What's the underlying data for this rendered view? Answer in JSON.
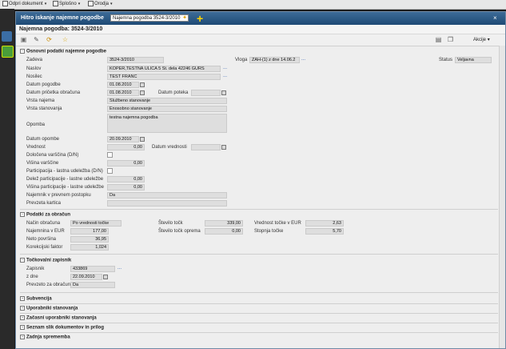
{
  "menu": {
    "items": [
      "Odpri dokument",
      "Splošno",
      "Orodja"
    ]
  },
  "window": {
    "title": "Hitro iskanje najemne pogodbe",
    "search_value": "Najemna pogodba 3524-3/2010",
    "close": "×"
  },
  "header": {
    "title": "Najemna pogodba: 3524-3/2010"
  },
  "toolbar": {
    "akcije": "Akcije"
  },
  "sections": {
    "osnovni": "Osnovni podatki najemne pogodbe",
    "obracun": "Podatki za obračun",
    "tockovalni": "Točkovalni zapisnik",
    "subvencija": "Subvencija",
    "uporabniki": "Uporabniki stanovanja",
    "zacasni": "Začasni uporabniki stanovanja",
    "seznam": "Seznam slik dokumentov in prilog",
    "zadnja": "Zadnja sprememba"
  },
  "osnovni": {
    "zadeva_label": "Zadeva",
    "zadeva": "3524-3/2010",
    "vloga_label": "Vloga",
    "vloga": "ZAH-(1) z dne 14.06.2",
    "status_label": "Status",
    "status": "Veljavna",
    "naslov_label": "Naslov",
    "naslov": "KOPER,TESTNA ULICA 5 Št. dela 42246 GURS",
    "nosilec_label": "Nosilec",
    "nosilec": "TEST FRANC",
    "datum_pogodbe_label": "Datum pogodbe",
    "datum_pogodbe": "01.08.2010",
    "datum_pricetka_label": "Datum pričetka obračuna",
    "datum_pricetka": "01.08.2010",
    "datum_poteka_label": "Datum poteka",
    "datum_poteka": "",
    "vrsta_najema_label": "Vrsta najema",
    "vrsta_najema": "Službeno stanovanje",
    "vrsta_stanovanja_label": "Vrsta stanovanja",
    "vrsta_stanovanja": "Enosobno stanovanje",
    "opomba_label": "Opomba",
    "opomba": "testna najemna pogodba",
    "datum_opombe_label": "Datum opombe",
    "datum_opombe": "20.09.2010",
    "vrednost_label": "Vrednost",
    "vrednost": "0,00",
    "datum_vrednosti_label": "Datum vrednosti",
    "datum_vrednosti": "",
    "dolocena_label": "Določena varščina (D/N)",
    "visina_varscine_label": "Višina varščine",
    "visina_varscine": "0,00",
    "participacija_label": "Participacija - lastna udeležba (D/N)",
    "delez_label": "Delež participacije - lastne udeležbe",
    "delez": "0,00",
    "visina_part_label": "Višina participacije - lastne udeležbe",
    "visina_part": "0,00",
    "najemnik_label": "Najemnik v prevnem postopku",
    "najemnik": "Da",
    "prevzeta_label": "Prevzeta kartica",
    "prevzeta": ""
  },
  "obracun": {
    "nacin_label": "Način obračuna",
    "nacin": "Po vrednosti točke",
    "najemnina_label": "Najemnina v EUR",
    "najemnina": "177,00",
    "neto_label": "Neto površina",
    "neto": "36,95",
    "korekcijski_label": "Korekcijski faktor",
    "korekcijski": "1,024",
    "stevilo_tock_label": "Število točk",
    "stevilo_tock": "339,00",
    "stevilo_tock_oprema_label": "Število točk oprema",
    "stevilo_tock_oprema": "0,00",
    "vrednost_tocke_label": "Vrednost točke v EUR",
    "vrednost_tocke": "2,63",
    "stopnja_label": "Stopnja točke",
    "stopnja": "5,70"
  },
  "tockovalni": {
    "zapisnik_label": "Zapisnik",
    "zapisnik": "433869",
    "z_dne_label": "z dne",
    "z_dne": "22.09.2010",
    "prevzeto_label": "Prevzeto za obračun",
    "prevzeto": "Da"
  }
}
